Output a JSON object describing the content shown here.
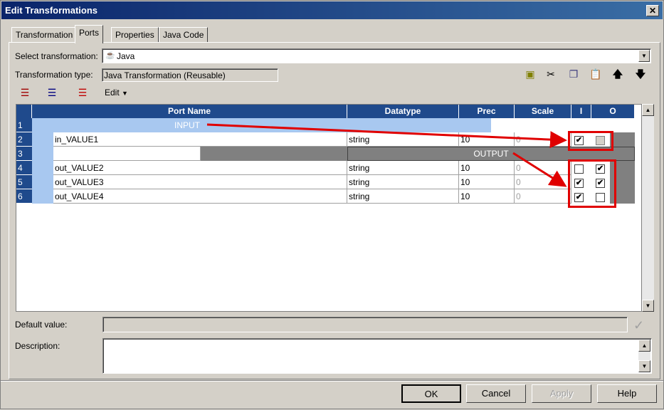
{
  "window": {
    "title": "Edit Transformations",
    "close": "✕"
  },
  "tabs": [
    "Transformation",
    "Ports",
    "Properties",
    "Java Code"
  ],
  "select_transformation": {
    "label": "Select transformation:",
    "value": "Java"
  },
  "transformation_type": {
    "label": "Transformation type:",
    "value": "Java Transformation (Reusable)"
  },
  "edit_menu": "Edit",
  "columns": {
    "name": "Port Name",
    "datatype": "Datatype",
    "prec": "Prec",
    "scale": "Scale",
    "i": "I",
    "o": "O"
  },
  "rows": [
    {
      "num": "1",
      "group": "INPUT"
    },
    {
      "num": "2",
      "name": "in_VALUE1",
      "datatype": "string",
      "prec": "10",
      "scale": "0",
      "i": true,
      "o": false
    },
    {
      "num": "3",
      "group": "OUTPUT"
    },
    {
      "num": "4",
      "name": "out_VALUE2",
      "datatype": "string",
      "prec": "10",
      "scale": "0",
      "i": false,
      "o": true
    },
    {
      "num": "5",
      "name": "out_VALUE3",
      "datatype": "string",
      "prec": "10",
      "scale": "0",
      "i": true,
      "o": true
    },
    {
      "num": "6",
      "name": "out_VALUE4",
      "datatype": "string",
      "prec": "10",
      "scale": "0",
      "i": true,
      "o": false
    }
  ],
  "default_value": {
    "label": "Default value:",
    "value": ""
  },
  "description": {
    "label": "Description:",
    "value": ""
  },
  "buttons": {
    "ok": "OK",
    "cancel": "Cancel",
    "apply": "Apply",
    "help": "Help"
  },
  "colors": {
    "header": "#1f4a8c",
    "group_bar": "#a8c8f0",
    "annotation": "#e00000"
  }
}
